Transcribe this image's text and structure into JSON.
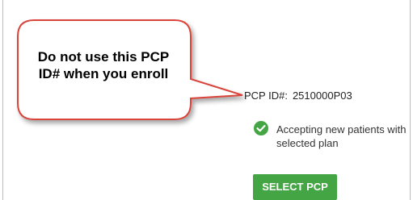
{
  "callout": {
    "text": "Do not use this PCP\nID# when you enroll",
    "border_color": "#d9443b"
  },
  "provider": {
    "pcp_id_label": "PCP ID#:",
    "pcp_id_value": "2510000P03",
    "status_icon": "check-circle-icon",
    "status_color": "#43a543",
    "status_text": "Accepting new patients with selected plan"
  },
  "actions": {
    "select_label": "SELECT PCP",
    "select_color": "#43a543"
  }
}
